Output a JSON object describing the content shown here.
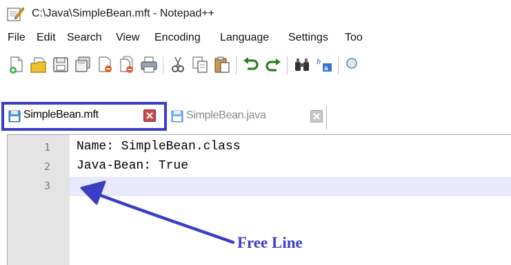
{
  "window": {
    "title": "C:\\Java\\SimpleBean.mft - Notepad++",
    "icon": "notepad-icon"
  },
  "menu": {
    "items": [
      "File",
      "Edit",
      "Search",
      "View",
      "Encoding",
      "Language",
      "Settings",
      "Too"
    ]
  },
  "toolbar": {
    "buttons": [
      "new-file-icon",
      "open-file-icon",
      "save-icon",
      "save-all-icon",
      "close-icon",
      "close-all-icon",
      "print-icon",
      "cut-icon",
      "copy-icon",
      "paste-icon",
      "undo-icon",
      "redo-icon",
      "find-icon",
      "replace-icon",
      "zoom-icon"
    ]
  },
  "tabs": [
    {
      "label": "SimpleBean.mft",
      "active": true
    },
    {
      "label": "SimpleBean.java",
      "active": false
    }
  ],
  "editor": {
    "lines": [
      {
        "number": "1",
        "text": "Name: SimpleBean.class"
      },
      {
        "number": "2",
        "text": "Java-Bean: True"
      },
      {
        "number": "3",
        "text": ""
      }
    ]
  },
  "annotation": {
    "text": "Free Line",
    "color": "#3b3ec4"
  },
  "colors": {
    "highlight": "#3b3ec4",
    "current_line": "#e8e8ff",
    "gutter": "#e4e4e4"
  }
}
